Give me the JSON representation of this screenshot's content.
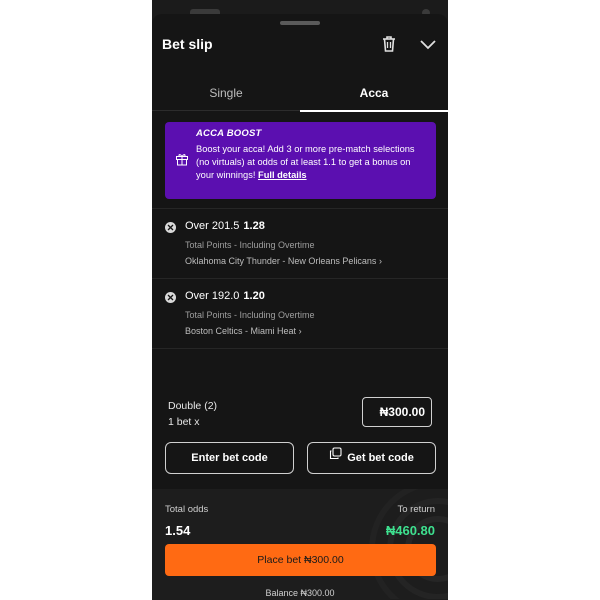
{
  "sheet": {
    "title": "Bet slip"
  },
  "tabs": [
    {
      "label": "Single",
      "active": false
    },
    {
      "label": "Acca",
      "active": true
    }
  ],
  "boost": {
    "title": "ACCA BOOST",
    "text": "Boost your acca! Add 3 or more pre-match selections (no virtuals) at odds of at least 1.1 to get a bonus on your winnings! ",
    "link": "Full details",
    "color": "#5b0fb0"
  },
  "selections": [
    {
      "pick": "Over 201.5",
      "odds": "1.28",
      "market": "Total Points - Including Overtime",
      "match": "Oklahoma City Thunder - New Orleans Pelicans"
    },
    {
      "pick": "Over 192.0",
      "odds": "1.20",
      "market": "Total Points - Including Overtime",
      "match": "Boston Celtics - Miami Heat"
    }
  ],
  "stake": {
    "type_label": "Double (2)",
    "bets_label": "1 bet x",
    "amount": "₦300.00"
  },
  "buttons": {
    "enter_code": "Enter bet code",
    "get_code": "Get bet code"
  },
  "footer": {
    "total_odds_label": "Total odds",
    "total_odds": "1.54",
    "to_return_label": "To return",
    "to_return": "₦460.80",
    "place_bet": "Place bet ₦300.00",
    "balance": "Balance ₦300.00"
  },
  "colors": {
    "accent": "#ff6a13",
    "return_green": "#3ee08f",
    "background": "#151515"
  }
}
